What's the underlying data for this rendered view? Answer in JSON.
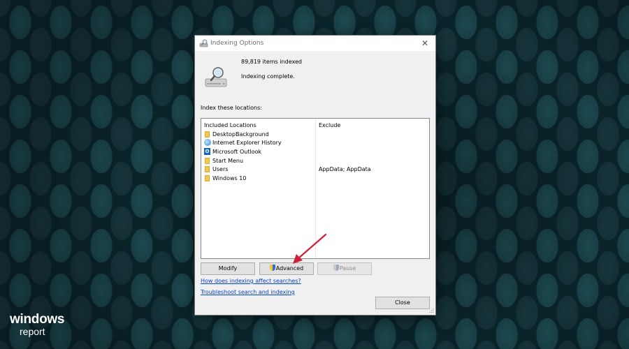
{
  "desktop": {
    "brand_line1": "windows",
    "brand_line2": "report"
  },
  "dialog": {
    "title": "Indexing Options",
    "close_glyph": "✕",
    "items_indexed": "89,819 items indexed",
    "status": "Indexing complete.",
    "section_label": "Index these locations:"
  },
  "locations": {
    "headers": {
      "included": "Included Locations",
      "exclude": "Exclude"
    },
    "rows": [
      {
        "icon": "folder-icon",
        "name": "DesktopBackground",
        "exclude": ""
      },
      {
        "icon": "internet-explorer-icon",
        "name": "Internet Explorer History",
        "exclude": ""
      },
      {
        "icon": "outlook-icon",
        "name": "Microsoft Outlook",
        "exclude": ""
      },
      {
        "icon": "folder-icon",
        "name": "Start Menu",
        "exclude": ""
      },
      {
        "icon": "folder-icon",
        "name": "Users",
        "exclude": "AppData; AppData"
      },
      {
        "icon": "folder-icon",
        "name": "Windows 10",
        "exclude": ""
      }
    ]
  },
  "buttons": {
    "modify": "Modify",
    "advanced": "Advanced",
    "pause": "Pause",
    "close": "Close"
  },
  "links": {
    "how_affect": "How does indexing affect searches?",
    "troubleshoot": "Troubleshoot search and indexing"
  },
  "colors": {
    "link": "#0645c8",
    "annotation_arrow": "#d11f3a",
    "folder": "#f2c94c"
  }
}
